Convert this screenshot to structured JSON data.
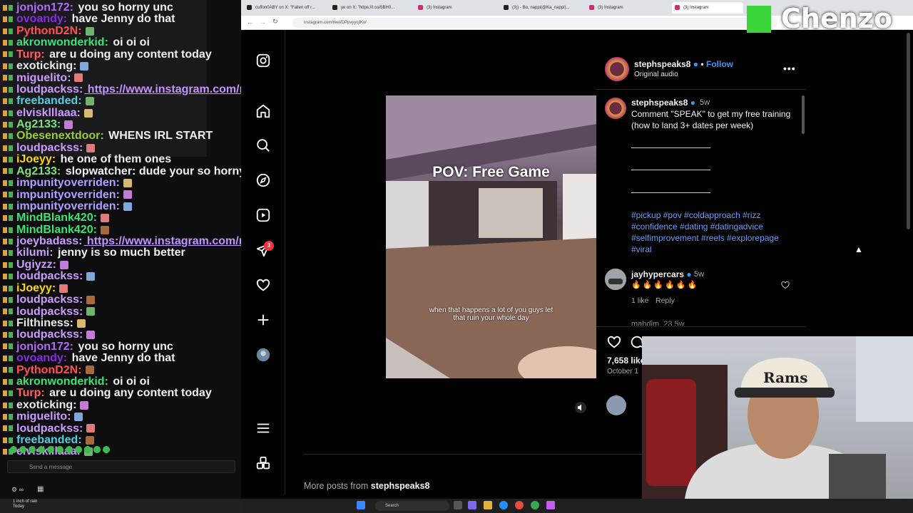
{
  "chat": {
    "lines": [
      {
        "user": "jonjon172",
        "msg": "you so horny unc",
        "color": "#b06cf2"
      },
      {
        "user": "ovoandy",
        "msg": "have Jenny do that",
        "color": "#8a2be2"
      },
      {
        "user": "PythonD2N",
        "msg": "",
        "color": "#ff4f4f"
      },
      {
        "user": "akronwonderkid",
        "msg": "oi oi oi",
        "color": "#3ae374"
      },
      {
        "user": "Turp",
        "msg": "are u doing any content today",
        "color": "#ff6060"
      },
      {
        "user": "exoticking",
        "msg": "",
        "color": "#e8e8e8"
      },
      {
        "user": "miguelito",
        "msg": "",
        "color": "#c99cff"
      },
      {
        "user": "loudpackss",
        "msg": "https://www.instagram.com/reel/DPe7gGGCQqD/",
        "color": "#c99cff"
      },
      {
        "user": "freebanded",
        "msg": "",
        "color": "#4dd0e1"
      },
      {
        "user": "elvisklllaaa",
        "msg": "",
        "color": "#c99cff"
      },
      {
        "user": "Ag2133",
        "msg": "",
        "color": "#7ee07e"
      },
      {
        "user": "Obesenextdoor",
        "msg": "WHENS IRL START",
        "color": "#9acd32"
      },
      {
        "user": "loudpackss",
        "msg": "",
        "color": "#c99cff"
      },
      {
        "user": "iJoeyy",
        "msg": "he one of them ones",
        "color": "#ffd700"
      },
      {
        "user": "Ag2133",
        "msg": "slopwatcher: dude your so horny",
        "color": "#7ee07e"
      },
      {
        "user": "impunityoverriden",
        "msg": "",
        "color": "#b39dff"
      },
      {
        "user": "impunityoverriden",
        "msg": "",
        "color": "#b39dff"
      },
      {
        "user": "impunityoverriden",
        "msg": "",
        "color": "#b39dff"
      },
      {
        "user": "MindBlank420",
        "msg": "",
        "color": "#3ae374"
      },
      {
        "user": "MindBlank420",
        "msg": "",
        "color": "#3ae374"
      },
      {
        "user": "joeybadass",
        "msg": "https://www.instagram.com/reel/DPpvyycjlKv/",
        "color": "#c99cff"
      },
      {
        "user": "kilumi",
        "msg": "jenny is so much better",
        "color": "#c99cff"
      },
      {
        "user": "Ugiyzz",
        "msg": "",
        "color": "#c99cff"
      },
      {
        "user": "loudpackss",
        "msg": "",
        "color": "#c99cff"
      },
      {
        "user": "iJoeyy",
        "msg": "",
        "color": "#ffd700"
      },
      {
        "user": "loudpackss",
        "msg": "",
        "color": "#c99cff"
      },
      {
        "user": "loudpackss",
        "msg": "",
        "color": "#c99cff"
      },
      {
        "user": "Filthiness",
        "msg": "",
        "color": "#e8e8e8"
      },
      {
        "user": "loudpackss",
        "msg": "",
        "color": "#c99cff"
      },
      {
        "user": "jonjon172",
        "msg": "you so horny unc",
        "color": "#b06cf2"
      },
      {
        "user": "ovoandy",
        "msg": "have Jenny do that",
        "color": "#8a2be2"
      },
      {
        "user": "PythonD2N",
        "msg": "",
        "color": "#ff4f4f"
      },
      {
        "user": "akronwonderkid",
        "msg": "oi oi oi",
        "color": "#3ae374"
      },
      {
        "user": "Turp",
        "msg": "are u doing any content today",
        "color": "#ff6060"
      },
      {
        "user": "exoticking",
        "msg": "",
        "color": "#e8e8e8"
      },
      {
        "user": "miguelito",
        "msg": "",
        "color": "#c99cff"
      },
      {
        "user": "loudpackss",
        "msg": "",
        "color": "#c99cff"
      },
      {
        "user": "freebanded",
        "msg": "",
        "color": "#4dd0e1"
      },
      {
        "user": "elvisklllaaa",
        "msg": "",
        "color": "#c99cff"
      }
    ],
    "input_placeholder": "Send a message"
  },
  "browser": {
    "tabs": [
      "cuffon0ABY on X: \"Fallen off r...",
      "ye on X: \"https://t.co/5BH0...",
      "(3) Instagram",
      "(3)) - Bo, nappi(@Ka_nappi)...",
      "(3) Instagram",
      "(3) Instagram"
    ],
    "url": "instagram.com/reel/DPpvyycjlKv/"
  },
  "instagram": {
    "notification_count": "3",
    "post": {
      "username": "stephspeaks8",
      "follow_label": "Follow",
      "audio": "Original audio",
      "more": "•••",
      "overlay_title": "POV: Free Game",
      "subtitle": "when that happens a lot of you guys let that ruin your whole day",
      "caption_time": "5w",
      "caption": "Comment \"SPEAK\" to get my free training (how to land 3+ dates per week)",
      "hashtags": "#pickup #pov #coldapproach #rizz #confidence #dating #datingadvice #selfimprovement #reels #explorepage #viral",
      "likes": "7,658 like",
      "date": "October 1"
    },
    "comment": {
      "username": "jayhypercars",
      "time": "5w",
      "text": "🔥🔥🔥🔥🔥🔥",
      "likes": "1 like",
      "reply": "Reply"
    },
    "next_comment_user": "mahdim_23 5w",
    "more_posts_prefix": "More posts from",
    "more_posts_user": "stephspeaks8"
  },
  "brand": {
    "name": "Chenzo",
    "accent": "#3bd43b"
  },
  "taskbar": {
    "search": "Search",
    "weather": "1 inch of rain\nToday"
  }
}
